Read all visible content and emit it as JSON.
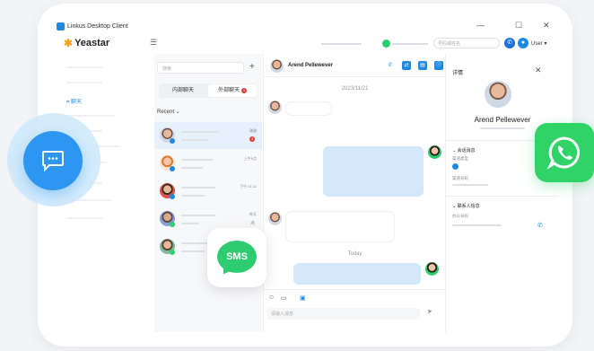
{
  "window": {
    "title": "Linkus Desktop Client",
    "controls": {
      "minimize": "—",
      "maximize": "☐",
      "close": "✕"
    }
  },
  "topbar": {
    "logo": "Yeastar",
    "search_placeholder": "号码或姓名",
    "user_label": "User"
  },
  "sidebar": {
    "active_item": "聊天"
  },
  "chat_list": {
    "search_placeholder": "搜索",
    "tabs": [
      {
        "label": "内部聊天"
      },
      {
        "label": "外部聊天",
        "badge": "3"
      }
    ],
    "recent_label": "Recent",
    "conversations": [
      {
        "time": "刚刚",
        "badge": "3",
        "channel": "messenger",
        "selected": true
      },
      {
        "time": "上午9点",
        "channel": "messenger"
      },
      {
        "time": "下午 01:11",
        "channel": "messenger"
      },
      {
        "time": "昨天",
        "sub": "点",
        "channel": "whatsapp"
      },
      {
        "time": "",
        "channel": "whatsapp"
      }
    ]
  },
  "chat": {
    "contact_name": "Arend Pellewever",
    "date_separator": "2023/11/21",
    "today_separator": "Today",
    "composer_placeholder": "请输入消息"
  },
  "details": {
    "title": "详情",
    "contact_name": "Arend Pellewever",
    "section_channel": "会话消息",
    "channel_type_label": "渠道类型",
    "channel_number_label": "渠道号码",
    "section_contact": "联系人信息",
    "office_phone_label": "办公号码"
  },
  "floating": {
    "sms_label": "SMS"
  },
  "colors": {
    "accent": "#1e88e5",
    "whatsapp": "#2fd366",
    "sms": "#2ecc71",
    "bubble_out": "#d4e8fb"
  }
}
